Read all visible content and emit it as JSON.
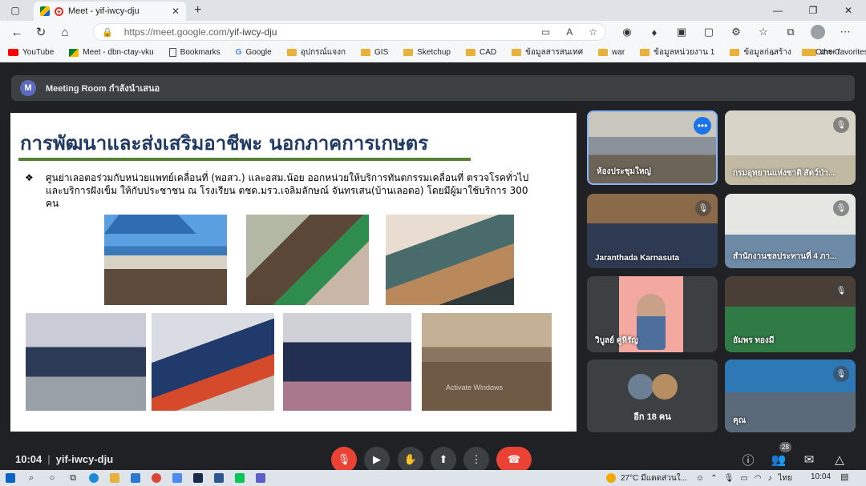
{
  "browser": {
    "tab_title": "Meet - yif-iwcy-dju",
    "url_host": "https://meet.google.com/",
    "url_path": "yif-iwcy-dju",
    "bookmarks": [
      "YouTube",
      "Meet - dbn-ctay-vku",
      "Bookmarks",
      "Google",
      "อุปกรณ์แจงก",
      "GIS",
      "Sketchup",
      "CAD",
      "ข้อมูลสารสนเทศ",
      "war",
      "ข้อมูลหน่วยงาน 1",
      "ข้อมูลก่อสร้าง",
      "เกร-0"
    ],
    "bookmarks_other": "Other favorites"
  },
  "meeting": {
    "avatar_letter": "M",
    "room_title": "Meeting Room กำลังนำเสนอ",
    "time": "10:04",
    "code": "yif-iwcy-dju",
    "participant_count": "28"
  },
  "slide": {
    "title": "การพัฒนาและส่งเสริมอาชีพะ นอกภาคการเกษตร",
    "bullet": "❖",
    "text": "ศูนย่าเลอตอร่วมกับหน่วยแพทย์เคลื่อนที่ (พอสว.)  และอสม.น้อย  ออกหน่วยให้บริการทันตกรรมเคลื่อนที่  ตรวจโรคทั่วไป และบริการฝังเข็ม ให้กับประชาชน ณ โรงเรียน ตชด.มรว.เจลิมลักษณ์ จันทรเสน(บ้านเลอตอ) โดยมีผู้มาใช้บริการ 300 คน",
    "watermark": "Activate Windows"
  },
  "participants": [
    {
      "name": "ห้องประชุมใหญ่",
      "muted": false
    },
    {
      "name": "กรมอุทยานแห่งชาติ สัตว์ป่า...",
      "muted": true
    },
    {
      "name": "Jaranthada Karnasuta",
      "muted": true
    },
    {
      "name": "สำนักงานชลประทานที่ 4 ภา...",
      "muted": true
    },
    {
      "name": "วิบูลย์ คู่หิรัญ",
      "muted": false
    },
    {
      "name": "อัมพร ทองมี",
      "muted": true
    },
    {
      "name": "อีก 18 คน",
      "muted": false
    },
    {
      "name": "คุณ",
      "muted": true
    }
  ],
  "taskbar": {
    "weather": "27°C  มีแดดส่วนใ...",
    "lang": "ไทย",
    "time": "10:04"
  }
}
